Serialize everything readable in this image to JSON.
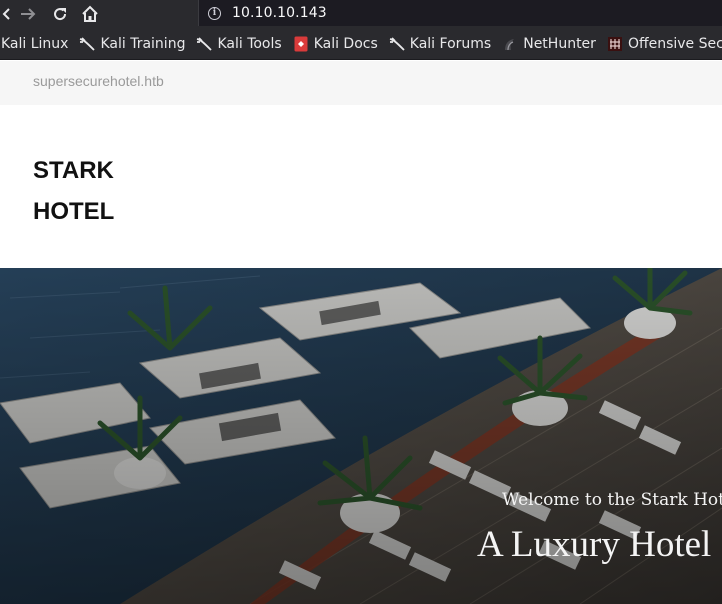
{
  "browser": {
    "url": "10.10.10.143",
    "bookmarks": [
      {
        "label": "Kali Linux",
        "icon": "kali-dragon-icon"
      },
      {
        "label": "Kali Training",
        "icon": "kali-dragon-icon"
      },
      {
        "label": "Kali Tools",
        "icon": "kali-dragon-icon"
      },
      {
        "label": "Kali Docs",
        "icon": "kali-docs-icon"
      },
      {
        "label": "Kali Forums",
        "icon": "kali-dragon-icon"
      },
      {
        "label": "NetHunter",
        "icon": "nethunter-icon"
      },
      {
        "label": "Offensive Securi",
        "icon": "offsec-icon"
      }
    ]
  },
  "page": {
    "domain": "supersecurehotel.htb",
    "brand_line1": "STARK",
    "brand_line2": "HOTEL",
    "hero_subtitle": "Welcome to the Stark Hotel",
    "hero_title": "A Luxury Hotel"
  }
}
